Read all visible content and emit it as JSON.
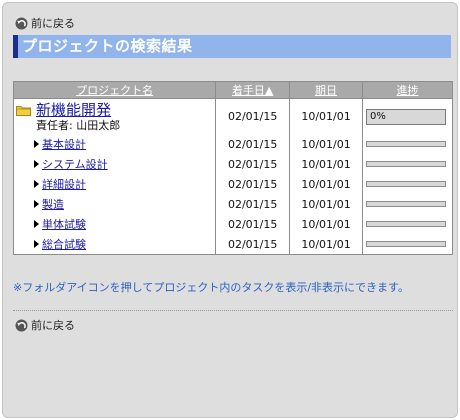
{
  "nav": {
    "back_label": "前に戻る"
  },
  "title": "プロジェクトの検索結果",
  "table": {
    "headers": {
      "name": "プロジェクト名",
      "start": "着手日▲",
      "due": "期日",
      "progress": "進捗"
    },
    "project": {
      "name": "新機能開発",
      "owner": "責任者: 山田太郎",
      "start": "02/01/15",
      "due": "10/01/01",
      "progress_label": "0%",
      "progress": 0
    },
    "tasks": [
      {
        "name": "基本設計",
        "start": "02/01/15",
        "due": "10/01/01",
        "progress": 0
      },
      {
        "name": "システム設計",
        "start": "02/01/15",
        "due": "10/01/01",
        "progress": 0
      },
      {
        "name": "詳細設計",
        "start": "02/01/15",
        "due": "10/01/01",
        "progress": 0
      },
      {
        "name": "製造",
        "start": "02/01/15",
        "due": "10/01/01",
        "progress": 0
      },
      {
        "name": "単体試験",
        "start": "02/01/15",
        "due": "10/01/01",
        "progress": 0
      },
      {
        "name": "総合試験",
        "start": "02/01/15",
        "due": "10/01/01",
        "progress": 0
      }
    ]
  },
  "note": "※フォルダアイコンを押してプロジェクト内のタスクを表示/非表示にできます。",
  "icons": {
    "back": "back-arrow-icon",
    "folder": "folder-icon",
    "expand": "triangle-right-icon"
  },
  "colors": {
    "title_bg": "#92b4ec",
    "title_accent": "#1a2e8a",
    "link": "#1a1aa6",
    "note": "#2a62c4"
  }
}
